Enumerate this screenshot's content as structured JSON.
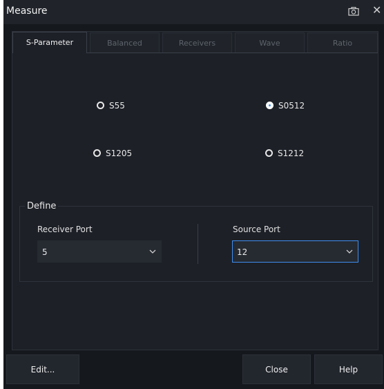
{
  "window": {
    "title": "Measure"
  },
  "tabs": [
    {
      "label": "S-Parameter",
      "active": true
    },
    {
      "label": "Balanced",
      "active": false
    },
    {
      "label": "Receivers",
      "active": false
    },
    {
      "label": "Wave",
      "active": false
    },
    {
      "label": "Ratio",
      "active": false
    }
  ],
  "params": [
    {
      "label": "S55",
      "selected": false
    },
    {
      "label": "S0512",
      "selected": true
    },
    {
      "label": "S1205",
      "selected": false
    },
    {
      "label": "S1212",
      "selected": false
    }
  ],
  "define": {
    "title": "Define",
    "receiver": {
      "label": "Receiver Port",
      "value": "5"
    },
    "source": {
      "label": "Source Port",
      "value": "12"
    }
  },
  "buttons": {
    "edit": "Edit...",
    "close": "Close",
    "help": "Help"
  },
  "colors": {
    "accent": "#3f8ef0",
    "background": "#15181d",
    "panel": "#1d2027"
  }
}
